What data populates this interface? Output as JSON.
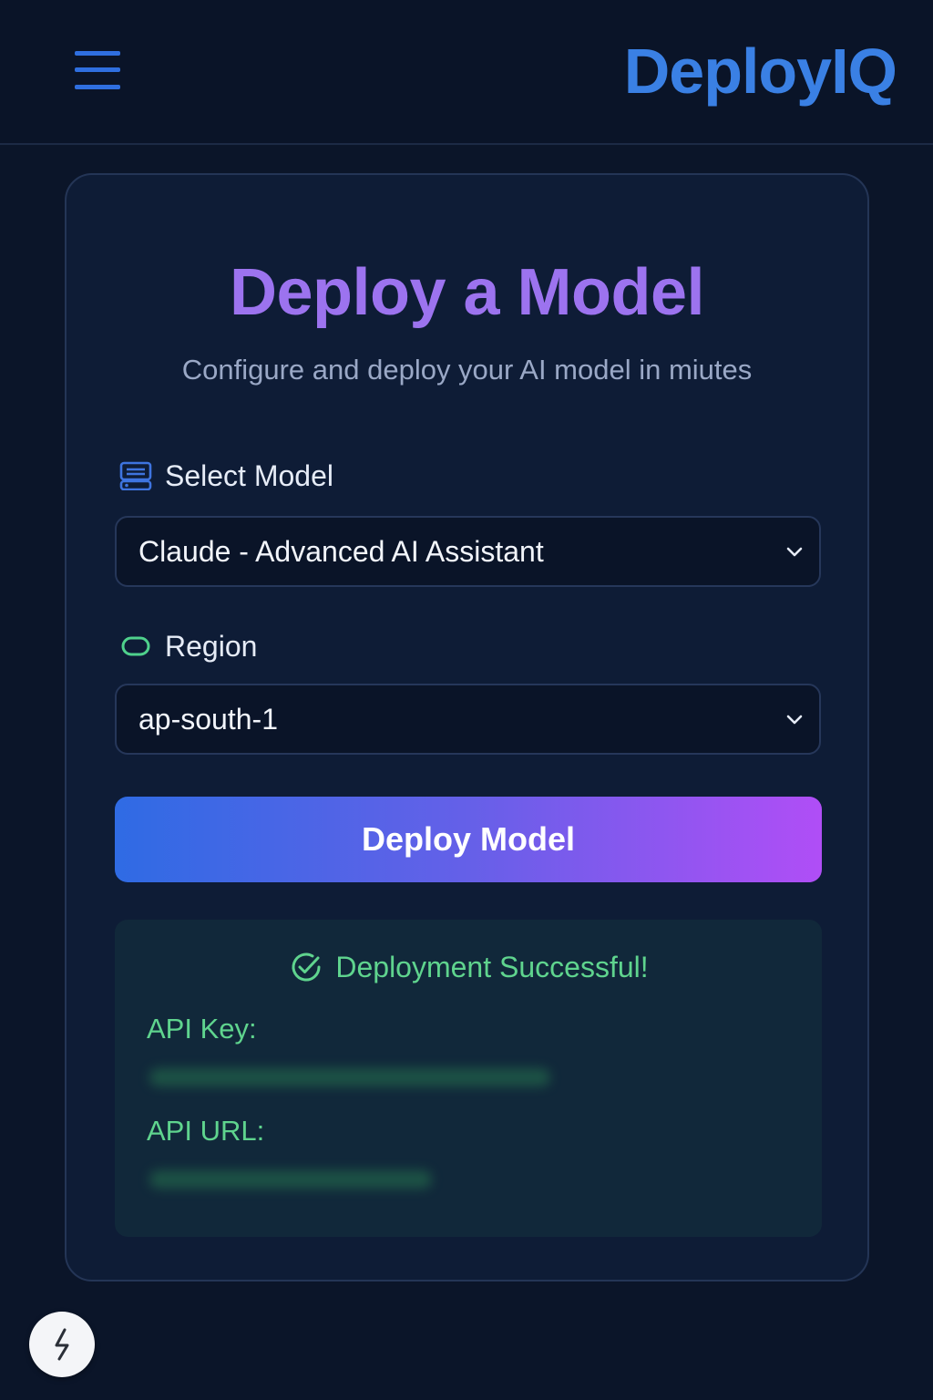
{
  "header": {
    "brand": "DeployIQ",
    "menu_icon": "hamburger-menu-icon"
  },
  "card": {
    "title": "Deploy a Model",
    "subtitle": "Configure and deploy your AI model in miutes"
  },
  "model_field": {
    "label": "Select Model",
    "icon": "server-icon",
    "selected_value": "Claude - Advanced AI Assistant"
  },
  "region_field": {
    "label": "Region",
    "icon": "region-pill-icon",
    "selected_value": "ap-south-1"
  },
  "deploy_button": {
    "label": "Deploy Model"
  },
  "result": {
    "status": "Deployment Successful!",
    "status_icon": "check-circle-icon",
    "api_key_label": "API Key:",
    "api_url_label": "API URL:"
  },
  "colors": {
    "background": "#0b1529",
    "brand": "#3a80e4",
    "title": "#9c73ef",
    "success": "#5fd48e",
    "button_gradient_start": "#2f6be4",
    "button_gradient_end": "#b04ef6"
  }
}
